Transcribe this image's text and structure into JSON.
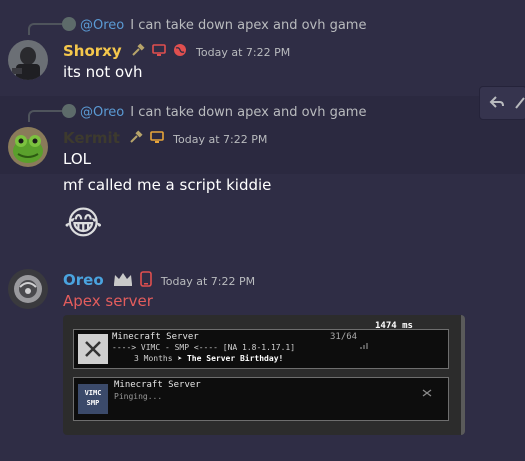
{
  "messages": [
    {
      "reply": {
        "mention": "@Oreo",
        "text": "I can take down apex and ovh game"
      },
      "username": "Shorxy",
      "username_color": "#f5c84c",
      "timestamp": "Today at 7:22 PM",
      "lines": [
        "its not ovh"
      ]
    },
    {
      "reply": {
        "mention": "@Oreo",
        "text": "I can take down apex and ovh game"
      },
      "username": "Kermit",
      "username_color": "#3d3a2e",
      "timestamp": "Today at 7:22 PM",
      "lines": [
        "LOL",
        "mf called me a script kiddie"
      ],
      "emoji": "😂"
    },
    {
      "username": "Oreo",
      "username_color": "#4aa3df",
      "timestamp": "Today at 7:22 PM",
      "lines": [
        "Apex server"
      ],
      "line_color": "#e35d5d",
      "embed": {
        "server1": {
          "title": "Minecraft Server",
          "players": "31/64",
          "latency": "1474 ms",
          "motd_line1": "----> VIMC - SMP <----  [NA 1.8-1.17.1]",
          "motd_line2": "3 Months",
          "motd_line2b": "➤ The Server Birthday!"
        },
        "server2": {
          "title": "Minecraft Server",
          "status": "Pinging...",
          "logo_text": "VIMC SMP"
        }
      }
    }
  ]
}
